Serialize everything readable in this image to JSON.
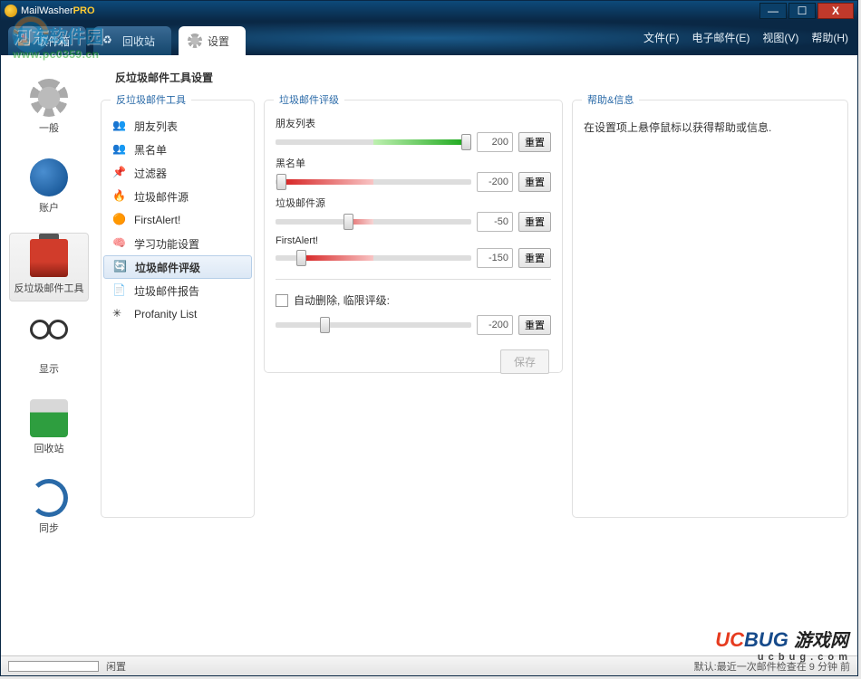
{
  "title": {
    "app": "MailWasher",
    "suffix": "PRO"
  },
  "winbtns": {
    "min": "—",
    "max": "☐",
    "close": "X"
  },
  "tabs": {
    "inbox": "收件箱",
    "recycle": "回收站",
    "settings": "设置"
  },
  "menus": {
    "file": "文件(F)",
    "email": "电子邮件(E)",
    "view": "视图(V)",
    "help": "帮助(H)"
  },
  "sidebar": {
    "items": [
      {
        "label": "一般"
      },
      {
        "label": "账户"
      },
      {
        "label": "反垃圾邮件工具"
      },
      {
        "label": "显示"
      },
      {
        "label": "回收站"
      },
      {
        "label": "同步"
      }
    ]
  },
  "page": {
    "title": "反垃圾邮件工具设置"
  },
  "panels": {
    "left": "反垃圾邮件工具",
    "mid": "垃圾邮件评级",
    "right": "帮助&信息"
  },
  "tools": {
    "items": [
      {
        "label": "朋友列表"
      },
      {
        "label": "黑名单"
      },
      {
        "label": "过滤器"
      },
      {
        "label": "垃圾邮件源"
      },
      {
        "label": "FirstAlert!"
      },
      {
        "label": "学习功能设置"
      },
      {
        "label": "垃圾邮件评级"
      },
      {
        "label": "垃圾邮件报告"
      },
      {
        "label": "Profanity List"
      }
    ]
  },
  "ratings": {
    "reset": "重置",
    "items": [
      {
        "label": "朋友列表",
        "value": "200",
        "thumb_pct": 97,
        "fill_from": 50,
        "fill_to": 97,
        "color_from": "#bef0b0",
        "color_to": "#1ca81c"
      },
      {
        "label": "黑名单",
        "value": "-200",
        "thumb_pct": 3,
        "fill_from": 3,
        "fill_to": 50,
        "color_from": "#d62020",
        "color_to": "#f8c4c4"
      },
      {
        "label": "垃圾邮件源",
        "value": "-50",
        "thumb_pct": 37,
        "fill_from": 37,
        "fill_to": 50,
        "color_from": "#e46a6a",
        "color_to": "#f6d4d4"
      },
      {
        "label": "FirstAlert!",
        "value": "-150",
        "thumb_pct": 13,
        "fill_from": 13,
        "fill_to": 50,
        "color_from": "#d62020",
        "color_to": "#f8c4c4"
      }
    ],
    "auto": {
      "label": "自动删除, 临限评级:",
      "value": "-200",
      "thumb_pct": 25
    },
    "save": "保存"
  },
  "help": {
    "text": "在设置项上悬停鼠标以获得帮助或信息."
  },
  "status": {
    "idle": "闲置",
    "right": "默认:最近一次邮件检查在 9 分钟 前"
  },
  "watermarks": {
    "wm1_line1": "河东软件园",
    "wm1_line2": "www.pc0359.cn",
    "wm2_uc": "UC",
    "wm2_bug": "BUG",
    "wm2_zh": "游戏网",
    "wm2_url": "u c b u g . c o m"
  }
}
